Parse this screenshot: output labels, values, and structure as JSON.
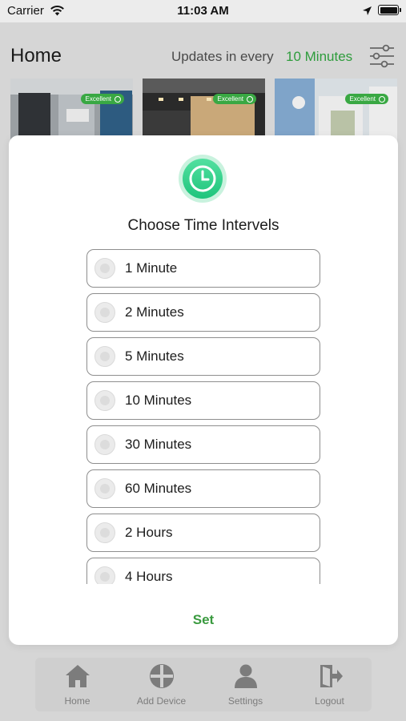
{
  "status_bar": {
    "carrier": "Carrier",
    "time": "11:03 AM",
    "icons": [
      "wifi-icon",
      "location-icon",
      "battery-icon"
    ]
  },
  "header": {
    "title": "Home",
    "update_prefix": "Updates in every",
    "update_value": "10 Minutes",
    "filter_icon": "filter-sliders-icon",
    "accent_color": "#2e9c3c"
  },
  "devices": [
    {
      "badge": "Excellent"
    },
    {
      "badge": "Excellent"
    },
    {
      "badge": "Excellent"
    }
  ],
  "modal": {
    "icon": "clock-icon",
    "title": "Choose Time Intervels",
    "options": [
      {
        "label": "1 Minute"
      },
      {
        "label": "2 Minutes"
      },
      {
        "label": "5 Minutes"
      },
      {
        "label": "10 Minutes"
      },
      {
        "label": "30 Minutes"
      },
      {
        "label": "60 Minutes"
      },
      {
        "label": "2 Hours"
      },
      {
        "label": "4 Hours"
      }
    ],
    "set_label": "Set",
    "set_color": "#3a9a3f"
  },
  "tab_bar": {
    "items": [
      {
        "label": "Home",
        "icon": "home-icon"
      },
      {
        "label": "Add Device",
        "icon": "add-device-icon"
      },
      {
        "label": "Settings",
        "icon": "user-icon"
      },
      {
        "label": "Logout",
        "icon": "logout-icon"
      }
    ]
  }
}
